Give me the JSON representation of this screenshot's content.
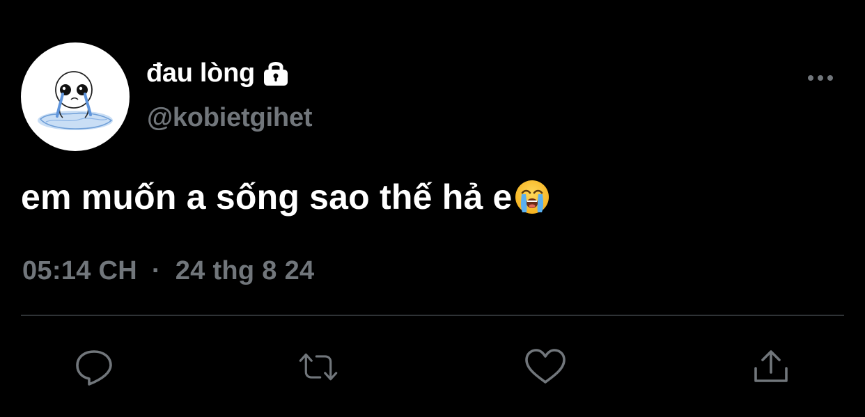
{
  "author": {
    "display_name": "đau lòng",
    "handle": "@kobietgihet",
    "protected_icon": "lock-icon",
    "avatar": "crying-doodle-avatar"
  },
  "tweet": {
    "text": "em muốn a sống sao thế hả e",
    "emoji": "loudly-crying-face"
  },
  "meta": {
    "time": "05:14 CH",
    "separator": "·",
    "date": "24 thg 8 24"
  },
  "actions": [
    {
      "name": "reply",
      "icon": "reply-icon"
    },
    {
      "name": "retweet",
      "icon": "retweet-icon"
    },
    {
      "name": "like",
      "icon": "heart-icon"
    },
    {
      "name": "share",
      "icon": "share-icon"
    }
  ],
  "more_icon": "more-icon",
  "colors": {
    "background": "#000000",
    "primary_text": "#ffffff",
    "secondary_text": "#71767b",
    "divider": "#2f3336",
    "icon": "#71767b"
  }
}
